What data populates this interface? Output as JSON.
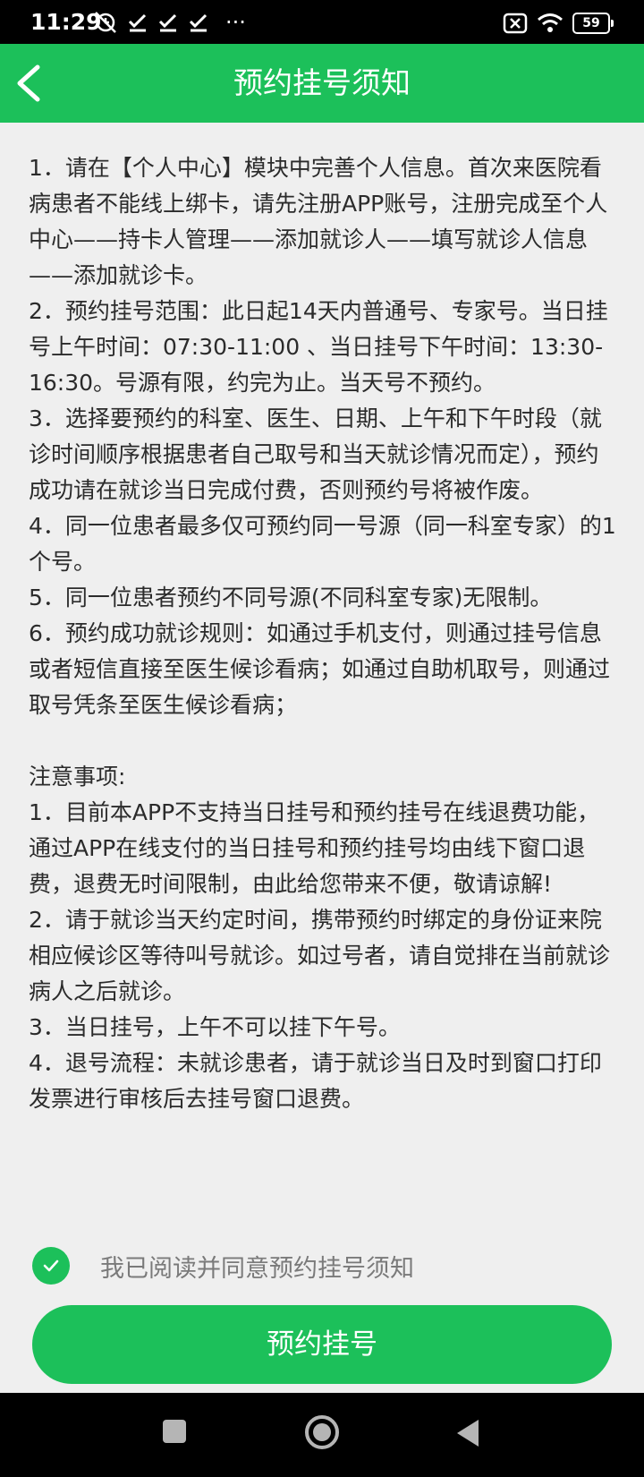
{
  "status_bar": {
    "time": "11:29",
    "overflow": "···",
    "battery": "59"
  },
  "header": {
    "title": "预约挂号须知"
  },
  "content": {
    "rules": [
      "1．请在【个人中心】模块中完善个人信息。首次来医院看病患者不能线上绑卡，请先注册APP账号，注册完成至个人中心——持卡人管理——添加就诊人——填写就诊人信息——添加就诊卡。",
      "2．预约挂号范围：此日起14天内普通号、专家号。当日挂号上午时间：07:30-11:00 、当日挂号下午时间：13:30-16:30。号源有限，约完为止。当天号不预约。",
      "3．选择要预约的科室、医生、日期、上午和下午时段（就诊时间顺序根据患者自己取号和当天就诊情况而定），预约成功请在就诊当日完成付费，否则预约号将被作废。",
      "4．同一位患者最多仅可预约同一号源（同一科室专家）的1个号。",
      "5．同一位患者预约不同号源(不同科室专家)无限制。",
      "6．预约成功就诊规则：如通过手机支付，则通过挂号信息或者短信直接至医生候诊看病；如通过自助机取号，则通过取号凭条至医生候诊看病；"
    ],
    "notice_title": "注意事项:",
    "notices": [
      "1．目前本APP不支持当日挂号和预约挂号在线退费功能，通过APP在线支付的当日挂号和预约挂号均由线下窗口退费，退费无时间限制，由此给您带来不便，敬请谅解!",
      "2．请于就诊当天约定时间，携带预约时绑定的身份证来院相应候诊区等待叫号就诊。如过号者，请自觉排在当前就诊病人之后就诊。",
      "3．当日挂号，上午不可以挂下午号。",
      "4．退号流程：未就诊患者，请于就诊当日及时到窗口打印发票进行审核后去挂号窗口退费。"
    ]
  },
  "agree": {
    "label": "我已阅读并同意预约挂号须知",
    "checked": true
  },
  "submit_label": "预约挂号",
  "colors": {
    "accent": "#1cc05a",
    "background": "#efefef",
    "text": "#2b2b2b"
  }
}
